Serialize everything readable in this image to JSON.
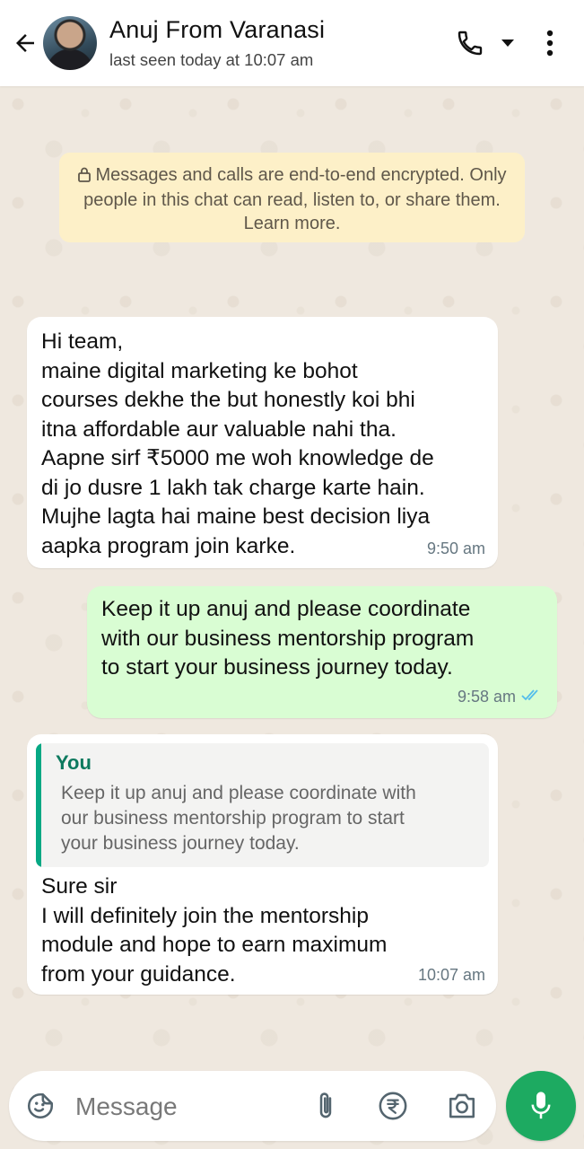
{
  "header": {
    "contact_name": "Anuj From Varanasi",
    "status": "last seen today at 10:07 am",
    "icons": [
      "back-arrow-icon",
      "avatar",
      "phone-icon",
      "dropdown-caret-icon",
      "more-vert-icon"
    ]
  },
  "encryption_notice": {
    "text": "Messages and calls are end-to-end encrypted. Only people in this chat can read, listen to, or share them. Learn more."
  },
  "messages": [
    {
      "direction": "incoming",
      "text": "Hi team,\nmaine digital marketing ke bohot\ncourses dekhe the but honestly koi bhi\nitna affordable aur valuable nahi tha.\nAapne sirf ₹5000 me woh knowledge de\ndi jo dusre 1 lakh tak charge karte hain.\nMujhe lagta hai maine best decision liya\naapka program join karke.",
      "time": "9:50 am"
    },
    {
      "direction": "outgoing",
      "text": "Keep it up anuj and please coordinate\nwith our business mentorship program\nto start your business journey today.",
      "time": "9:58 am",
      "status": "read"
    },
    {
      "direction": "incoming",
      "quote": {
        "author": "You",
        "text": "Keep it up anuj and please coordinate with\nour business mentorship program to start\nyour business journey today."
      },
      "text": "Sure sir\nI will definitely join the mentorship\nmodule and hope to earn maximum\nfrom your guidance.",
      "time": "10:07 am"
    }
  ],
  "composer": {
    "placeholder": "Message",
    "value": ""
  },
  "colors": {
    "outgoing_bubble": "#d9fdd3",
    "incoming_bubble": "#ffffff",
    "accent_green": "#1daa61",
    "read_ticks": "#53bdeb",
    "notice_bg": "#fdf0c8"
  }
}
